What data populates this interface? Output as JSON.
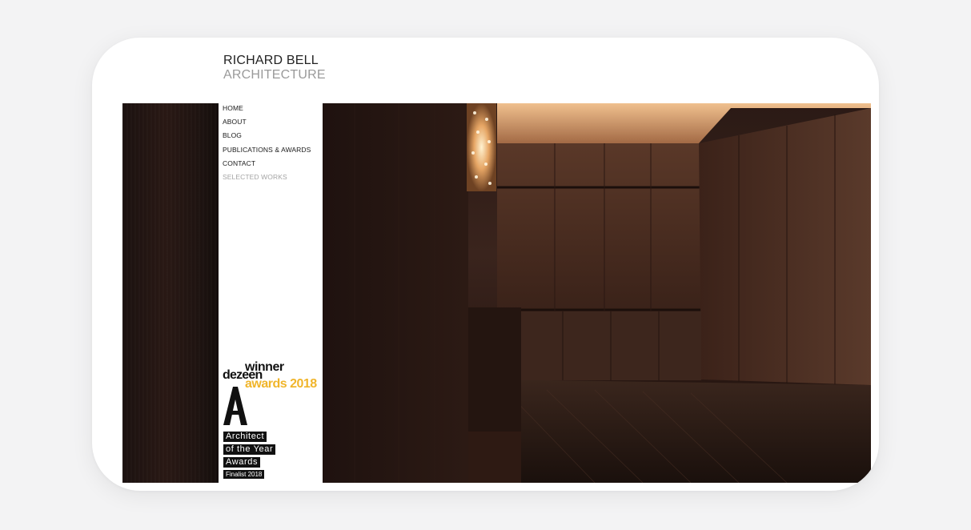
{
  "brand": {
    "line1": "RICHARD BELL",
    "line2": "ARCHITECTURE"
  },
  "nav": {
    "items": [
      {
        "label": "HOME"
      },
      {
        "label": "ABOUT"
      },
      {
        "label": "BLOG"
      },
      {
        "label": "PUBLICATIONS & AWARDS"
      },
      {
        "label": "CONTACT"
      },
      {
        "label": "SELECTED WORKS"
      }
    ]
  },
  "awards": {
    "dezeen": {
      "winner": "winner",
      "dezeen": "dezeen",
      "awards": "awards 2018",
      "accent_color": "#f0b52b"
    },
    "architect_of_year": {
      "line1": "Architect",
      "line2": "of the Year",
      "line3": "Awards",
      "finalist": "Finalist 2018"
    }
  },
  "hero": {
    "icon": "interior-photo",
    "colors": {
      "wood_dark": "#2a1813",
      "wood_light": "#6b4433",
      "ceiling_glow": "#e6b27f"
    }
  }
}
